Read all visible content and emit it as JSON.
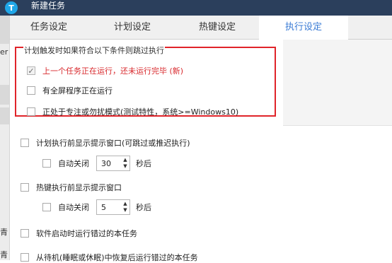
{
  "window": {
    "title": "新建任务",
    "icon_letter": "T",
    "icon_name": "app-logo-icon"
  },
  "tabs": [
    {
      "label": "任务设定",
      "active": false
    },
    {
      "label": "计划设定",
      "active": false
    },
    {
      "label": "热键设定",
      "active": false
    },
    {
      "label": "执行设定",
      "active": true
    }
  ],
  "skip_group": {
    "title": "计划触发时如果符合以下条件则跳过执行",
    "options": [
      {
        "label": "上一个任务正在运行，还未运行完毕 (新)",
        "checked": true,
        "highlight": true
      },
      {
        "label": "有全屏程序正在运行",
        "checked": false
      },
      {
        "label": "正处于专注或勿扰模式(测试特性，系统>=Windows10)",
        "checked": false
      }
    ]
  },
  "prompt_before_plan": {
    "label": "计划执行前显示提示窗口(可跳过或推迟执行)",
    "checked": false,
    "auto_close": {
      "label": "自动关闭",
      "checked": false,
      "value": "30",
      "unit": "秒后"
    }
  },
  "prompt_before_hotkey": {
    "label": "热键执行前显示提示窗口",
    "checked": false,
    "auto_close": {
      "label": "自动关闭",
      "checked": false,
      "value": "5",
      "unit": "秒后"
    }
  },
  "run_missed_on_start": {
    "label": "软件启动时运行错过的本任务",
    "checked": false
  },
  "run_missed_on_resume": {
    "label": "从待机(睡眠或休眠)中恢复后运行错过的本任务",
    "checked": false
  },
  "background_fragments": {
    "frag1": "er",
    "frag2": "青",
    "frag3": "青"
  },
  "colors": {
    "titlebar": "#2b3f5c",
    "accent": "#3a7bd5",
    "highlight_border": "#e0242a",
    "highlight_text": "#d8282c"
  }
}
